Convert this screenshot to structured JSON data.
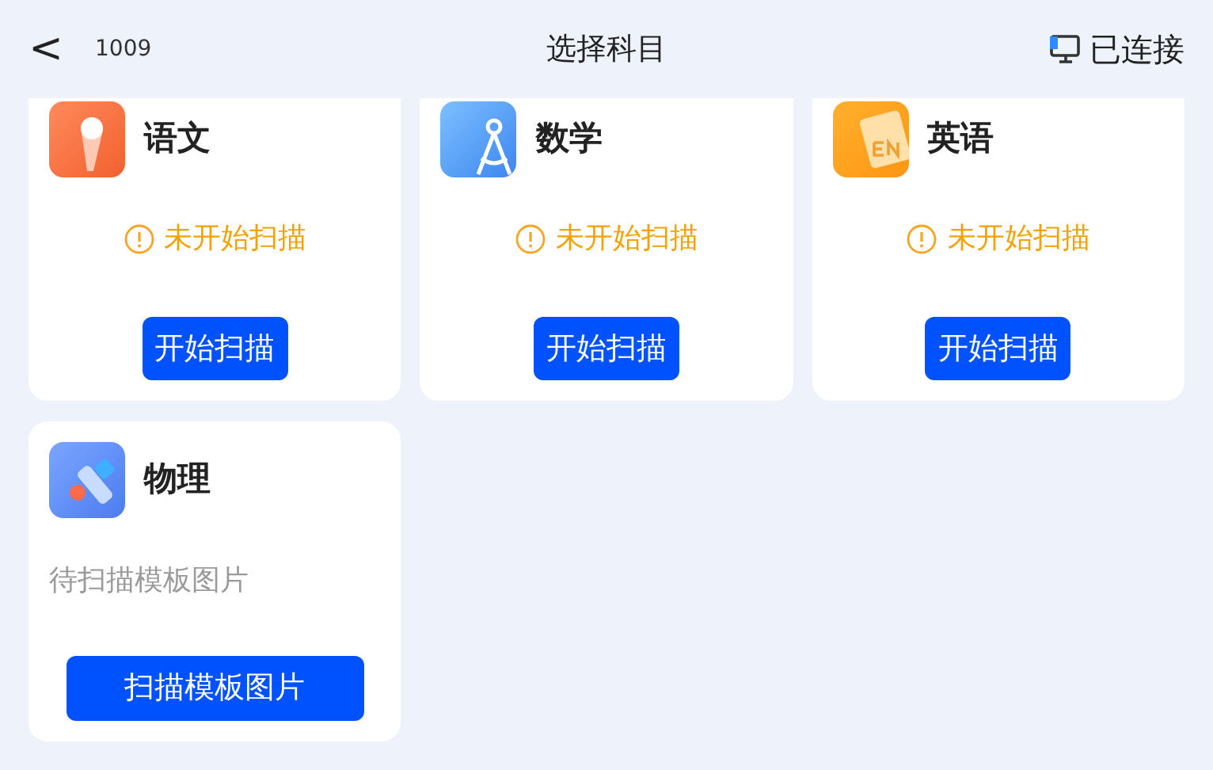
{
  "header": {
    "back": "<",
    "code": "1009",
    "title": "选择科目",
    "connection": "已连接"
  },
  "subjects": [
    {
      "name": "语文",
      "kind": "status",
      "status": "未开始扫描",
      "button": "开始扫描"
    },
    {
      "name": "数学",
      "kind": "status",
      "status": "未开始扫描",
      "button": "开始扫描"
    },
    {
      "name": "英语",
      "kind": "status",
      "status": "未开始扫描",
      "button": "开始扫描"
    },
    {
      "name": "物理",
      "kind": "pending",
      "status": "待扫描模板图片",
      "button": "扫描模板图片"
    }
  ]
}
